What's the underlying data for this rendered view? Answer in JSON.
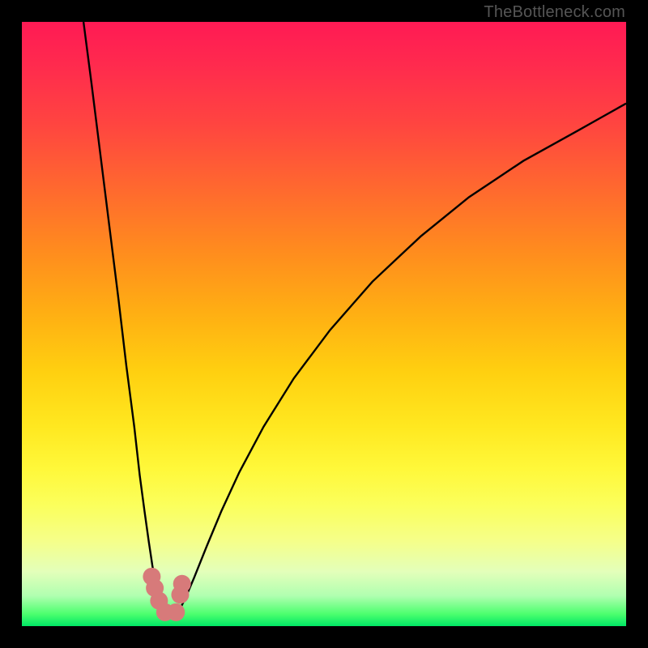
{
  "attribution": "TheBottleneck.com",
  "chart_data": {
    "type": "line",
    "title": "",
    "xlabel": "",
    "ylabel": "",
    "xlim": [
      0,
      100
    ],
    "ylim": [
      0,
      100
    ],
    "grid": false,
    "series": [
      {
        "name": "left-curve",
        "x": [
          10.2,
          11.5,
          13.0,
          14.5,
          16.0,
          17.3,
          18.6,
          19.5,
          20.3,
          21.0,
          21.6,
          22.1,
          22.5,
          22.8,
          23.0
        ],
        "values": [
          100,
          90,
          78,
          66,
          54,
          43,
          33,
          25,
          19,
          14,
          10,
          7,
          5,
          3.5,
          2.5
        ]
      },
      {
        "name": "right-curve",
        "x": [
          26.0,
          27.0,
          28.5,
          30.5,
          33.0,
          36.0,
          40.0,
          45.0,
          51.0,
          58.0,
          66.0,
          74.0,
          83.0,
          92.0,
          100.0
        ],
        "values": [
          2.5,
          4.5,
          8.0,
          13.0,
          19.0,
          25.5,
          33.0,
          41.0,
          49.0,
          57.0,
          64.5,
          71.0,
          77.0,
          82.0,
          86.5
        ]
      }
    ],
    "points": {
      "name": "minimum-cluster",
      "color": "#d77a7a",
      "x": [
        21.5,
        22.0,
        22.7,
        23.7,
        25.5,
        26.2,
        26.5
      ],
      "values": [
        8.2,
        6.3,
        4.2,
        2.3,
        2.3,
        5.2,
        7.0
      ]
    },
    "gradient_stops": [
      {
        "pos": 0.0,
        "color": "#ff1a54"
      },
      {
        "pos": 0.38,
        "color": "#ff8c1e"
      },
      {
        "pos": 0.74,
        "color": "#fff83a"
      },
      {
        "pos": 1.0,
        "color": "#00e765"
      }
    ]
  }
}
